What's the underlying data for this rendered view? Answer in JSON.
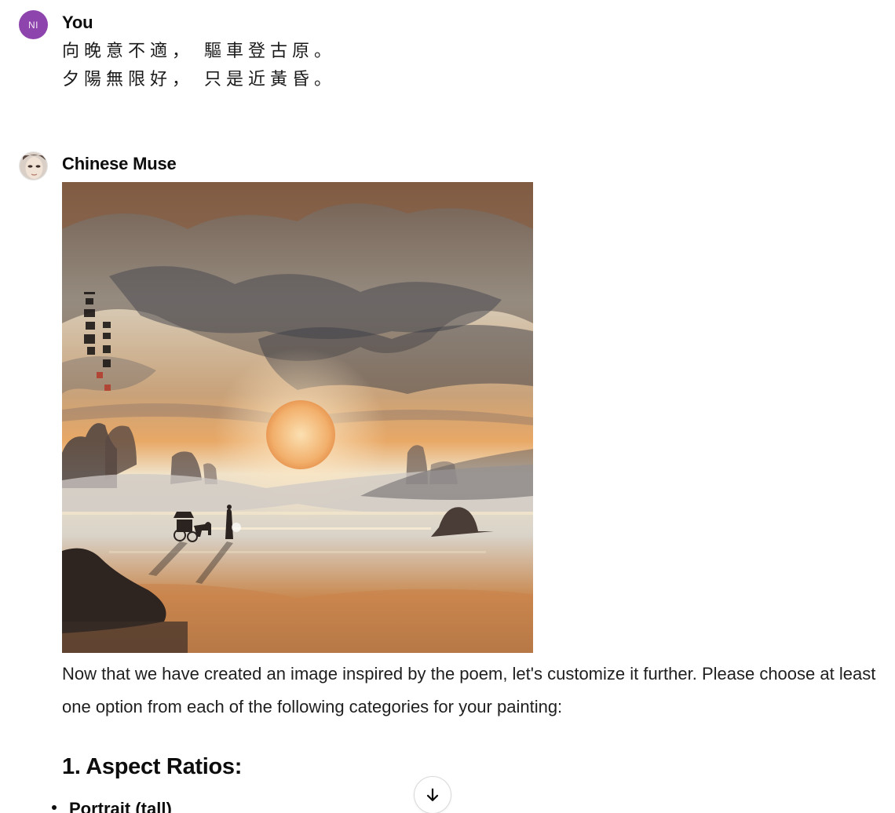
{
  "user_message": {
    "avatar_initials": "NI",
    "avatar_color": "#8e44ad",
    "author": "You",
    "poem_lines": [
      "向晚意不適， 驅車登古原。",
      "夕陽無限好， 只是近黃昏。"
    ]
  },
  "assistant_message": {
    "author": "Chinese Muse",
    "image": {
      "subject": "ink-wash painting of a sunset over a misty plain with a horse carriage and a standing figure",
      "calligraphy": "題花樓 林楚儀賦"
    },
    "paragraph": "Now that we have created an image inspired by the poem, let's customize it further. Please choose at least one option from each of the following categories for your painting:",
    "section_heading": "1. Aspect Ratios:",
    "options": [
      "Portrait (tall)"
    ]
  },
  "scroll_button": {
    "icon": "arrow-down-icon"
  }
}
